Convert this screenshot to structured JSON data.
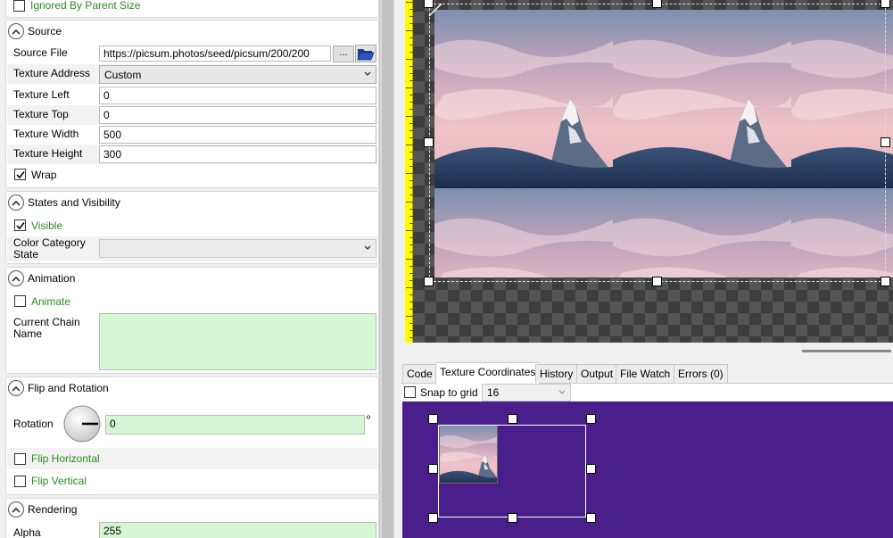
{
  "ignored_by_parent": {
    "label": "Ignored By Parent Size",
    "checked": false
  },
  "source": {
    "title": "Source",
    "source_file_label": "Source File",
    "source_file_value": "https://picsum.photos/seed/picsum/200/200",
    "browse_label": "...",
    "texture_address_label": "Texture Address",
    "texture_address_value": "Custom",
    "texture_left_label": "Texture Left",
    "texture_left_value": "0",
    "texture_top_label": "Texture Top",
    "texture_top_value": "0",
    "texture_width_label": "Texture Width",
    "texture_width_value": "500",
    "texture_height_label": "Texture Height",
    "texture_height_value": "300",
    "wrap_label": "Wrap",
    "wrap_checked": true
  },
  "states": {
    "title": "States and Visibility",
    "visible_label": "Visible",
    "visible_checked": true,
    "color_category_label_1": "Color Category",
    "color_category_label_2": "State",
    "color_category_value": ""
  },
  "animation": {
    "title": "Animation",
    "animate_label": "Animate",
    "animate_checked": false,
    "chain_label_1": "Current Chain",
    "chain_label_2": "Name",
    "chain_value": ""
  },
  "flip": {
    "title": "Flip and Rotation",
    "rotation_label": "Rotation",
    "rotation_value": "0",
    "rotation_unit": "º",
    "flip_h_label": "Flip Horizontal",
    "flip_h_checked": false,
    "flip_v_label": "Flip Vertical",
    "flip_v_checked": false
  },
  "rendering": {
    "title": "Rendering",
    "alpha_label": "Alpha",
    "alpha_value": "255"
  },
  "tabs": [
    {
      "label": "Code",
      "active": false
    },
    {
      "label": "Texture Coordinates",
      "active": true
    },
    {
      "label": "History",
      "active": false
    },
    {
      "label": "Output",
      "active": false
    },
    {
      "label": "File Watch",
      "active": false
    },
    {
      "label": "Errors (0)",
      "active": false
    }
  ],
  "snap": {
    "label": "Snap to grid",
    "checked": false,
    "grid_value": "16"
  },
  "colors": {
    "green_text": "#2a8b22",
    "green_field": "#d6f7d4",
    "coords_bg": "#4a1f8c",
    "ruler": "#fffd00"
  },
  "icons": [
    "collapse-up-icon",
    "checkmark-icon",
    "folder-open-icon",
    "chevron-down-icon",
    "rotation-dial-icon"
  ]
}
